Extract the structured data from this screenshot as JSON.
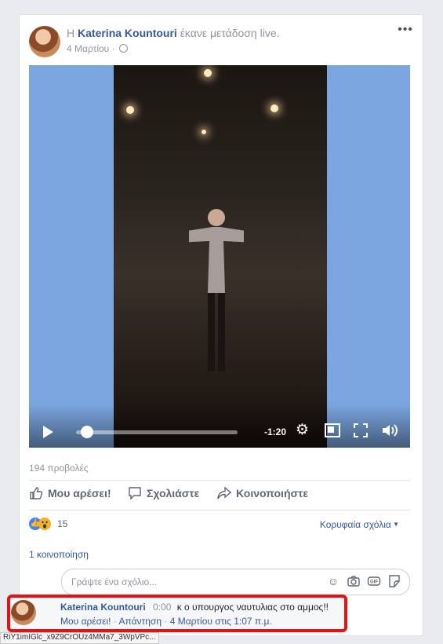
{
  "post": {
    "prefix": "Η",
    "author": "Katerina Kountouri",
    "action": "έκανε μετάδοση live.",
    "date": "4 Μαρτίου",
    "date_sep": "·",
    "more_label": "•••"
  },
  "video": {
    "remaining_time": "-1:20",
    "progress_fraction": 0.07
  },
  "stats": {
    "views": "194 προβολές",
    "reactions_count": "15",
    "top_comments": "Κορυφαία σχόλια",
    "shares": "1 κοινοποίηση"
  },
  "actions": {
    "like": "Μου αρέσει!",
    "comment": "Σχολιάστε",
    "share": "Κοινοποιήστε"
  },
  "comment_box": {
    "placeholder": "Γράψτε ένα σχόλιο..."
  },
  "comment": {
    "author": "Katerina Kountouri",
    "timestamp": "0:00",
    "text": "κ ο υπουργος ναυτυλιας στο αμμος!!",
    "like": "Μου αρέσει!",
    "dot1": "·",
    "reply": "Απάντηση",
    "dot2": "·",
    "date": "4 Μαρτίου στις 1:07 π.μ."
  },
  "statusbar": {
    "url": "RiY1imIGlc_x9Z9CrOUz4MMa7_3WpVPc..."
  },
  "colors": {
    "link": "#365899",
    "highlight": "#e81010",
    "video_bg": "#7aa5df"
  }
}
